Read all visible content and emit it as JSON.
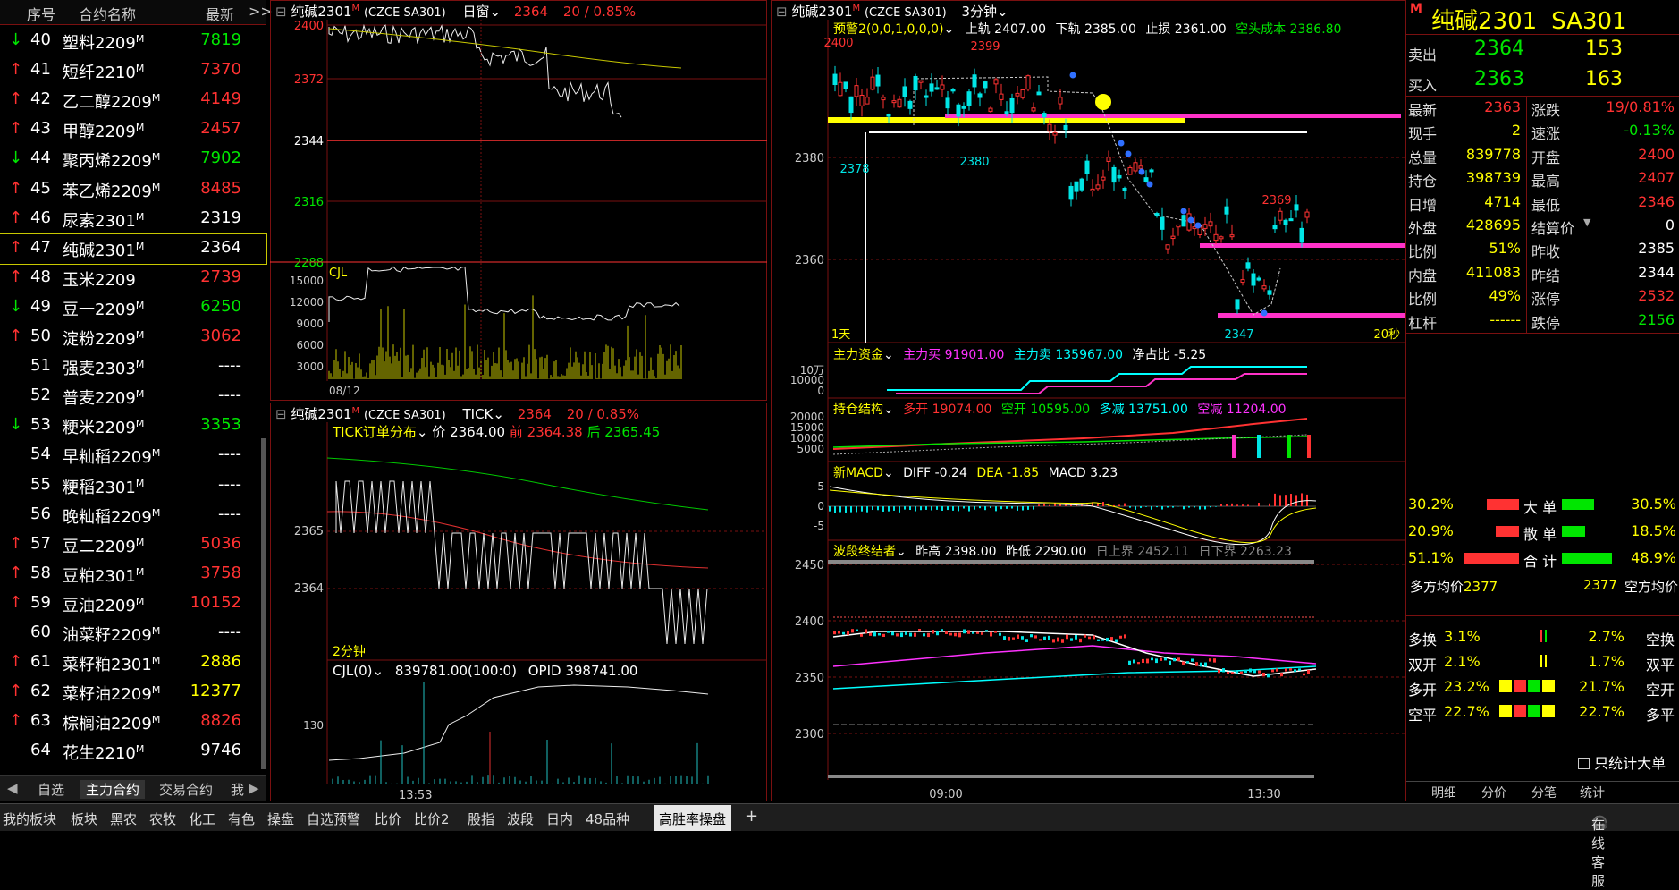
{
  "left": {
    "headers": [
      "序号",
      "合约名称",
      "最新"
    ],
    "expand": ">>",
    "rows": [
      {
        "dir": "down",
        "no": "40",
        "name": "塑料2209",
        "m": "M",
        "price": "7819",
        "pc": "green"
      },
      {
        "dir": "up",
        "no": "41",
        "name": "短纤2210",
        "m": "M",
        "price": "7370",
        "pc": "red"
      },
      {
        "dir": "up",
        "no": "42",
        "name": "乙二醇2209",
        "m": "M",
        "price": "4149",
        "pc": "red"
      },
      {
        "dir": "up",
        "no": "43",
        "name": "甲醇2209",
        "m": "M",
        "price": "2457",
        "pc": "red"
      },
      {
        "dir": "down",
        "no": "44",
        "name": "聚丙烯2209",
        "m": "M",
        "price": "7902",
        "pc": "green"
      },
      {
        "dir": "up",
        "no": "45",
        "name": "苯乙烯2209",
        "m": "M",
        "price": "8485",
        "pc": "red"
      },
      {
        "dir": "up",
        "no": "46",
        "name": "尿素2301",
        "m": "M",
        "price": "2319",
        "pc": "white"
      },
      {
        "dir": "up",
        "no": "47",
        "name": "纯碱2301",
        "m": "M",
        "price": "2364",
        "pc": "white",
        "sel": true
      },
      {
        "dir": "up",
        "no": "48",
        "name": "玉米2209",
        "m": "",
        "price": "2739",
        "pc": "red"
      },
      {
        "dir": "down",
        "no": "49",
        "name": "豆一2209",
        "m": "M",
        "price": "6250",
        "pc": "green"
      },
      {
        "dir": "up",
        "no": "50",
        "name": "淀粉2209",
        "m": "M",
        "price": "3062",
        "pc": "red"
      },
      {
        "dir": "",
        "no": "51",
        "name": "强麦2303",
        "m": "M",
        "price": "----",
        "pc": "white"
      },
      {
        "dir": "",
        "no": "52",
        "name": "普麦2209",
        "m": "M",
        "price": "----",
        "pc": "white"
      },
      {
        "dir": "down",
        "no": "53",
        "name": "粳米2209",
        "m": "M",
        "price": "3353",
        "pc": "green"
      },
      {
        "dir": "",
        "no": "54",
        "name": "早籼稻2209",
        "m": "M",
        "price": "----",
        "pc": "white"
      },
      {
        "dir": "",
        "no": "55",
        "name": "粳稻2301",
        "m": "M",
        "price": "----",
        "pc": "white"
      },
      {
        "dir": "",
        "no": "56",
        "name": "晚籼稻2209",
        "m": "M",
        "price": "----",
        "pc": "white"
      },
      {
        "dir": "up",
        "no": "57",
        "name": "豆二2209",
        "m": "M",
        "price": "5036",
        "pc": "red"
      },
      {
        "dir": "up",
        "no": "58",
        "name": "豆粕2301",
        "m": "M",
        "price": "3758",
        "pc": "red"
      },
      {
        "dir": "up",
        "no": "59",
        "name": "豆油2209",
        "m": "M",
        "price": "10152",
        "pc": "red"
      },
      {
        "dir": "",
        "no": "60",
        "name": "油菜籽2209",
        "m": "M",
        "price": "----",
        "pc": "white"
      },
      {
        "dir": "up",
        "no": "61",
        "name": "菜籽粕2301",
        "m": "M",
        "price": "2886",
        "pc": "yellow"
      },
      {
        "dir": "up",
        "no": "62",
        "name": "菜籽油2209",
        "m": "M",
        "price": "12377",
        "pc": "yellow"
      },
      {
        "dir": "up",
        "no": "63",
        "name": "棕榈油2209",
        "m": "M",
        "price": "8826",
        "pc": "red"
      },
      {
        "dir": "",
        "no": "64",
        "name": "花生2210",
        "m": "M",
        "price": "9746",
        "pc": "white"
      }
    ],
    "tabs": [
      "自选",
      "主力合约",
      "交易合约",
      "我"
    ]
  },
  "mid_top": {
    "title": "纯碱2301",
    "m": "M",
    "code": "(CZCE SA301)",
    "period": "日窗",
    "price": "2364",
    "change": "20 / 0.85%",
    "yticks": [
      "2400",
      "2372",
      "2344",
      "2316",
      "2288"
    ],
    "vol_label": "CJL",
    "vol_ticks": [
      "15000",
      "12000",
      "9000",
      "6000",
      "3000"
    ],
    "date": "08/12"
  },
  "mid_bot": {
    "title": "纯碱2301",
    "m": "M",
    "code": "(CZCE SA301)",
    "period": "TICK",
    "price": "2364",
    "change": "20 / 0.85%",
    "dist_label": "TICK订单分布",
    "dist_price_lbl": "价",
    "dist_price": "2364.00",
    "dist_prev_lbl": "前",
    "dist_prev": "2364.38",
    "dist_next_lbl": "后",
    "dist_next": "2365.45",
    "yticks": [
      "2365",
      "2364"
    ],
    "period2": "2分钟",
    "cjl_label": "CJL(0)",
    "cjl_vals": "839781.00(100:0)",
    "opid": "OPID 398741.00",
    "cjl_tick": "130",
    "time": "13:53"
  },
  "right": {
    "title": "纯碱2301",
    "m": "M",
    "code": "(CZCE SA301)",
    "period": "3分钟",
    "alert": "预警2(0,0,1,0,0,0)",
    "upper": "上轨 2407.00",
    "lower": "下轨 2385.00",
    "stop": "止损 2361.00",
    "cost": "空头成本 2386.80",
    "yticks": [
      "2380",
      "2360"
    ],
    "marks": [
      "2400",
      "2399",
      "2378",
      "2380",
      "2369",
      "2347"
    ],
    "day": "1天",
    "sec": "20秒",
    "fund_label": "主力资金",
    "fund_buy": "主力买 91901.00",
    "fund_sell": "主力卖 135967.00",
    "net": "净占比 -5.25",
    "fund_ticks": [
      "10万",
      "10000",
      "0"
    ],
    "pos_label": "持仓结构",
    "pos1": "多开 19074.00",
    "pos2": "空开 10595.00",
    "pos3": "多减 13751.00",
    "pos4": "空减 11204.00",
    "pos_ticks": [
      "20000",
      "15000",
      "10000",
      "5000"
    ],
    "macd_label": "新MACD",
    "diff": "DIFF -0.24",
    "dea": "DEA -1.85",
    "macd": "MACD 3.23",
    "macd_ticks": [
      "5",
      "0",
      "-5"
    ],
    "wave_label": "波段终结者",
    "hi": "昨高 2398.00",
    "lo": "昨低 2290.00",
    "up_b": "日上界 2452.11",
    "dn_b": "日下界 2263.23",
    "wave_ticks": [
      "2450",
      "2400",
      "2350",
      "2300"
    ],
    "times": [
      "09:00",
      "13:30"
    ]
  },
  "quote": {
    "m": "M",
    "name": "纯碱2301",
    "code": "SA301",
    "sell_lbl": "卖出",
    "sell_p": "2364",
    "sell_v": "153",
    "buy_lbl": "买入",
    "buy_p": "2363",
    "buy_v": "163",
    "rows": [
      [
        "最新",
        "2363",
        "red",
        "涨跌",
        "19/0.81%",
        "red"
      ],
      [
        "现手",
        "2",
        "yellow",
        "速涨",
        "-0.13%",
        "green"
      ],
      [
        "总量",
        "839778",
        "yellow",
        "开盘",
        "2400",
        "red"
      ],
      [
        "持仓",
        "398739",
        "yellow",
        "最高",
        "2407",
        "red"
      ],
      [
        "日增",
        "4714",
        "yellow",
        "最低",
        "2346",
        "red"
      ],
      [
        "外盘",
        "428695",
        "yellow",
        "结算价",
        "0",
        "white"
      ],
      [
        "比例",
        "51%",
        "yellow",
        "昨收",
        "2385",
        "white"
      ],
      [
        "内盘",
        "411083",
        "yellow",
        "昨结",
        "2344",
        "white"
      ],
      [
        "比例",
        "49%",
        "yellow",
        "涨停",
        "2532",
        "red"
      ],
      [
        "杠杆",
        "------",
        "yellow",
        "跌停",
        "2156",
        "green"
      ]
    ],
    "flow": [
      [
        "30.2%",
        "大 单",
        "30.5%"
      ],
      [
        "20.9%",
        "散 单",
        "18.5%"
      ],
      [
        "51.1%",
        "合 计",
        "48.9%"
      ]
    ],
    "avg_l": "多方均价",
    "avg_lv": "2377",
    "avg_rv": "2377",
    "avg_r": "空方均价",
    "stats": [
      [
        "多换",
        "3.1%",
        "2.7%",
        "空换"
      ],
      [
        "双开",
        "2.1%",
        "1.7%",
        "双平"
      ],
      [
        "多开",
        "23.2%",
        "21.7%",
        "空开"
      ],
      [
        "空平",
        "22.7%",
        "22.7%",
        "多平"
      ]
    ],
    "only_big": "只统计大单",
    "tabs": [
      "明细",
      "分价",
      "分笔",
      "统计"
    ]
  },
  "bottom": {
    "tabs": [
      "我的板块",
      "板块",
      "黑农",
      "农牧",
      "化工",
      "有色",
      "操盘",
      "自选预警",
      "比价",
      "比价2",
      "股指",
      "波段",
      "日内",
      "48品种",
      "高胜率操盘"
    ],
    "plus": "+",
    "service": "在线客服"
  }
}
